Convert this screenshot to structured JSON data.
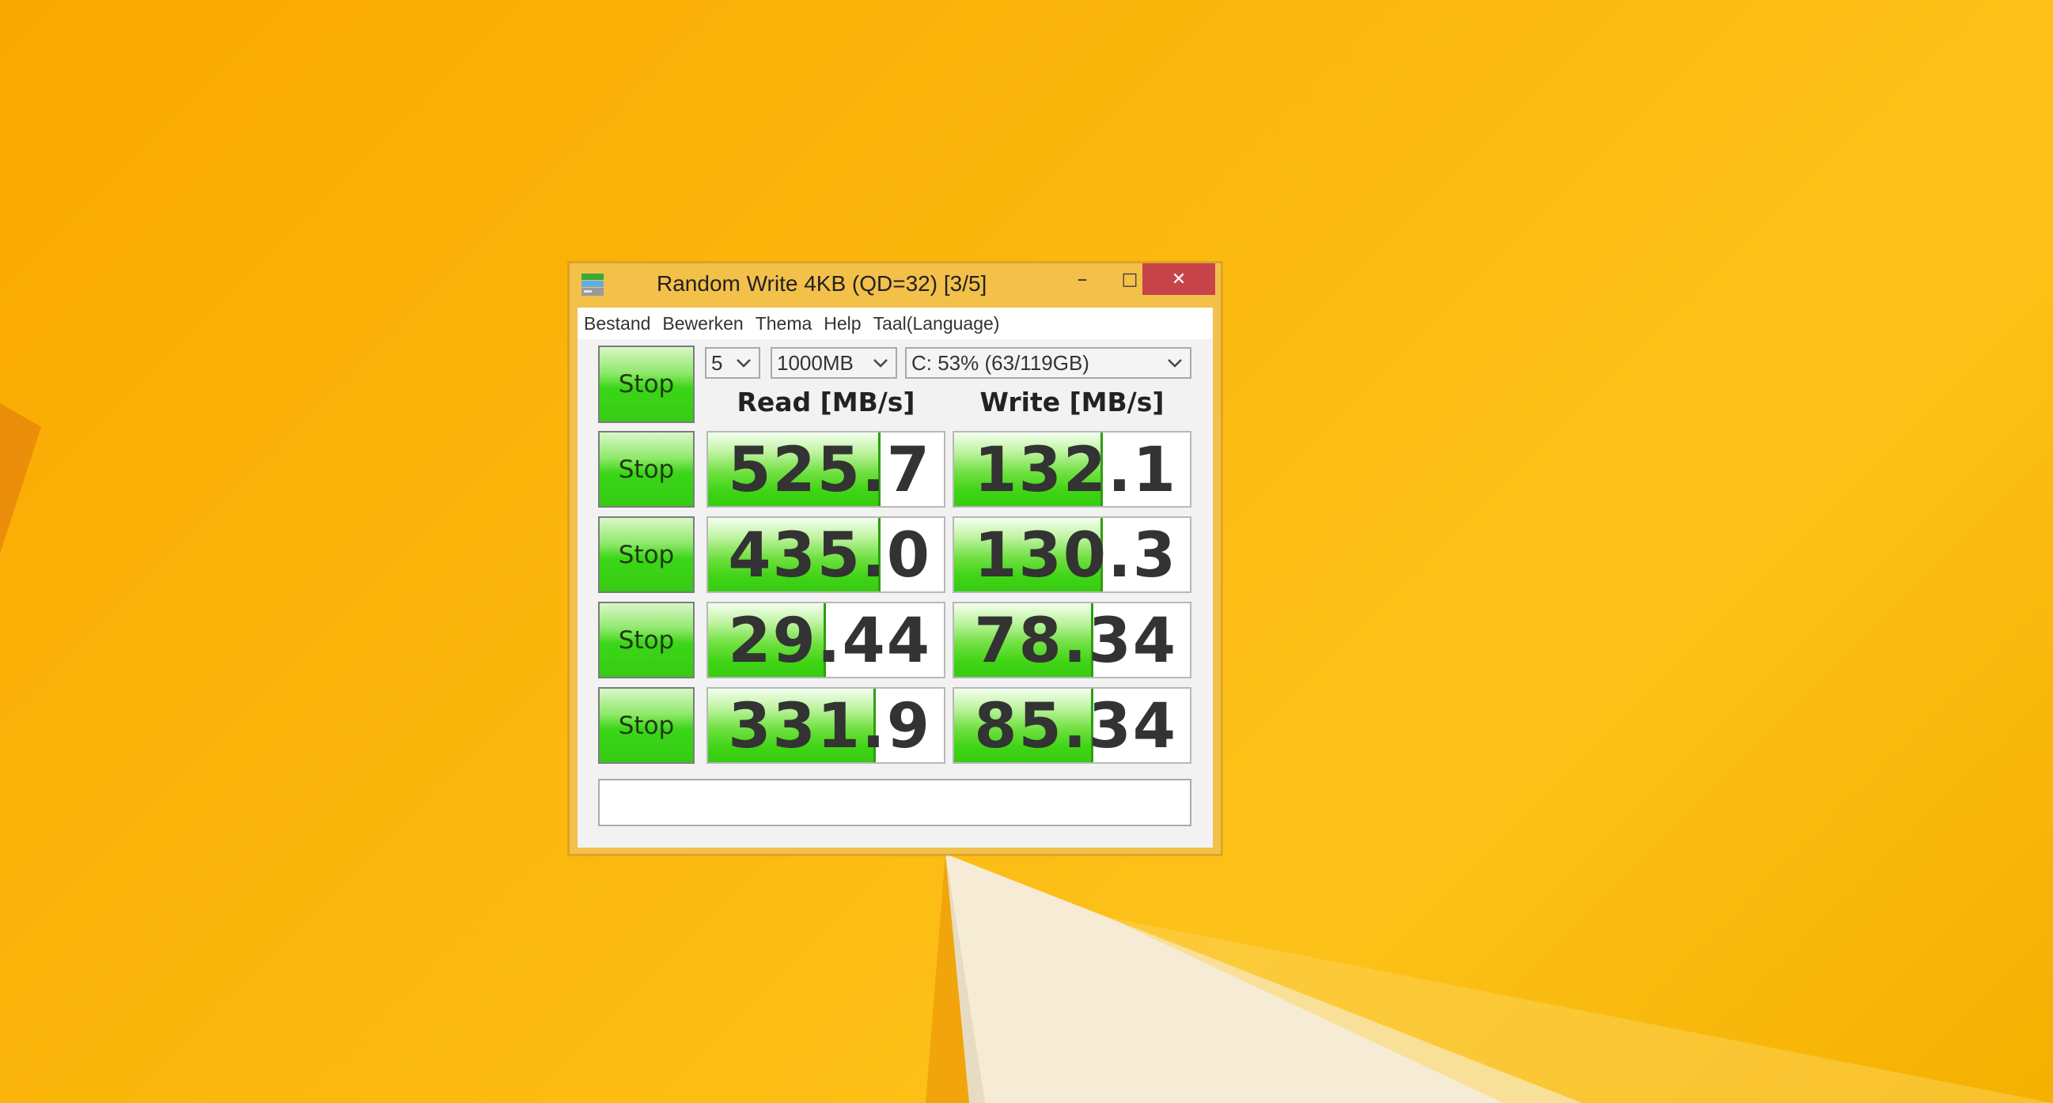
{
  "window": {
    "title": "Random Write 4KB (QD=32) [3/5]",
    "minimize_glyph": "–",
    "maximize_glyph": "□",
    "close_glyph": "✕"
  },
  "menu": {
    "items": [
      "Bestand",
      "Bewerken",
      "Thema",
      "Help",
      "Taal(Language)"
    ]
  },
  "controls": {
    "all_button_label": "Stop",
    "test_count": "5",
    "test_size": "1000MB",
    "drive": "C: 53% (63/119GB)"
  },
  "headers": {
    "read": "Read [MB/s]",
    "write": "Write [MB/s]"
  },
  "results": [
    {
      "button_label": "Stop",
      "read": "525.7",
      "write": "132.1",
      "read_fill": 0.72,
      "write_fill": 0.62
    },
    {
      "button_label": "Stop",
      "read": "435.0",
      "write": "130.3",
      "read_fill": 0.72,
      "write_fill": 0.62
    },
    {
      "button_label": "Stop",
      "read": "29.44",
      "write": "78.34",
      "read_fill": 0.49,
      "write_fill": 0.58
    },
    {
      "button_label": "Stop",
      "read": "331.9",
      "write": "85.34",
      "read_fill": 0.7,
      "write_fill": 0.58
    }
  ],
  "comment": "",
  "colors": {
    "desktop": "#f9b10a",
    "bar_green": "#3bd617",
    "close_red": "#c7444a"
  }
}
